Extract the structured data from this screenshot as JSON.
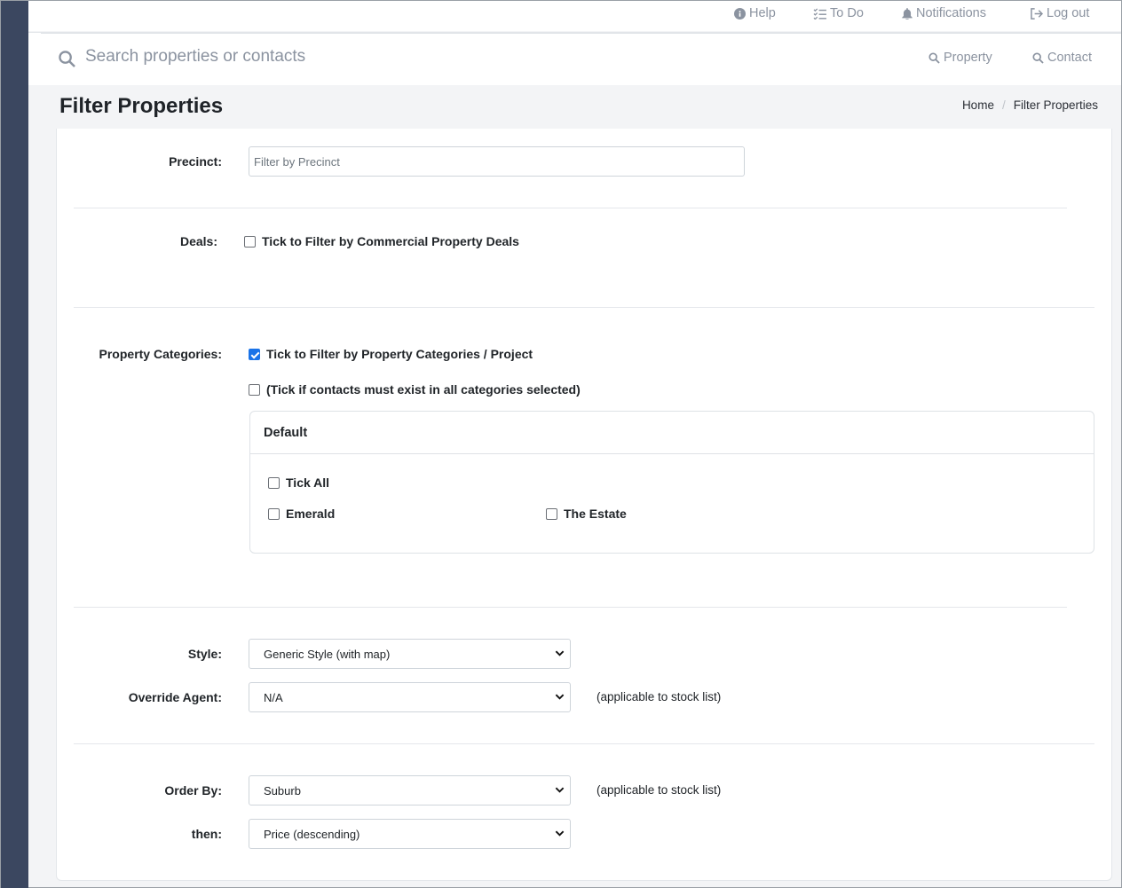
{
  "topbar": {
    "help": "Help",
    "todo": "To Do",
    "notifications": "Notifications",
    "logout": "Log out"
  },
  "search": {
    "placeholder": "Search properties or contacts",
    "property_link": "Property",
    "contact_link": "Contact"
  },
  "page": {
    "title": "Filter Properties",
    "breadcrumb": [
      "Home",
      "/",
      "Filter Properties"
    ]
  },
  "form": {
    "precinct": {
      "label": "Precinct:",
      "placeholder": "Filter by Precinct",
      "value": ""
    },
    "deals": {
      "label": "Deals:",
      "checkbox_label": "Tick to Filter by Commercial Property Deals",
      "checked": false
    },
    "categories": {
      "label": "Property Categories:",
      "filter_checkbox_label": "Tick to Filter by Property Categories / Project",
      "filter_checked": true,
      "all_prefix": "(Tick if contacts must exist in ",
      "all_bold": "all",
      "all_suffix": " categories selected)",
      "all_checked": false,
      "panel": {
        "title": "Default",
        "tick_all": "Tick All",
        "items": [
          "Emerald",
          "The Estate"
        ]
      }
    },
    "style": {
      "label": "Style:",
      "value": "Generic Style (with map)"
    },
    "override_agent": {
      "label": "Override Agent:",
      "value": "N/A",
      "note": "(applicable to stock list)"
    },
    "order_by": {
      "label": "Order By:",
      "value": "Suburb",
      "note": "(applicable to stock list)"
    },
    "then": {
      "label": "then:",
      "value": "Price (descending)"
    }
  }
}
